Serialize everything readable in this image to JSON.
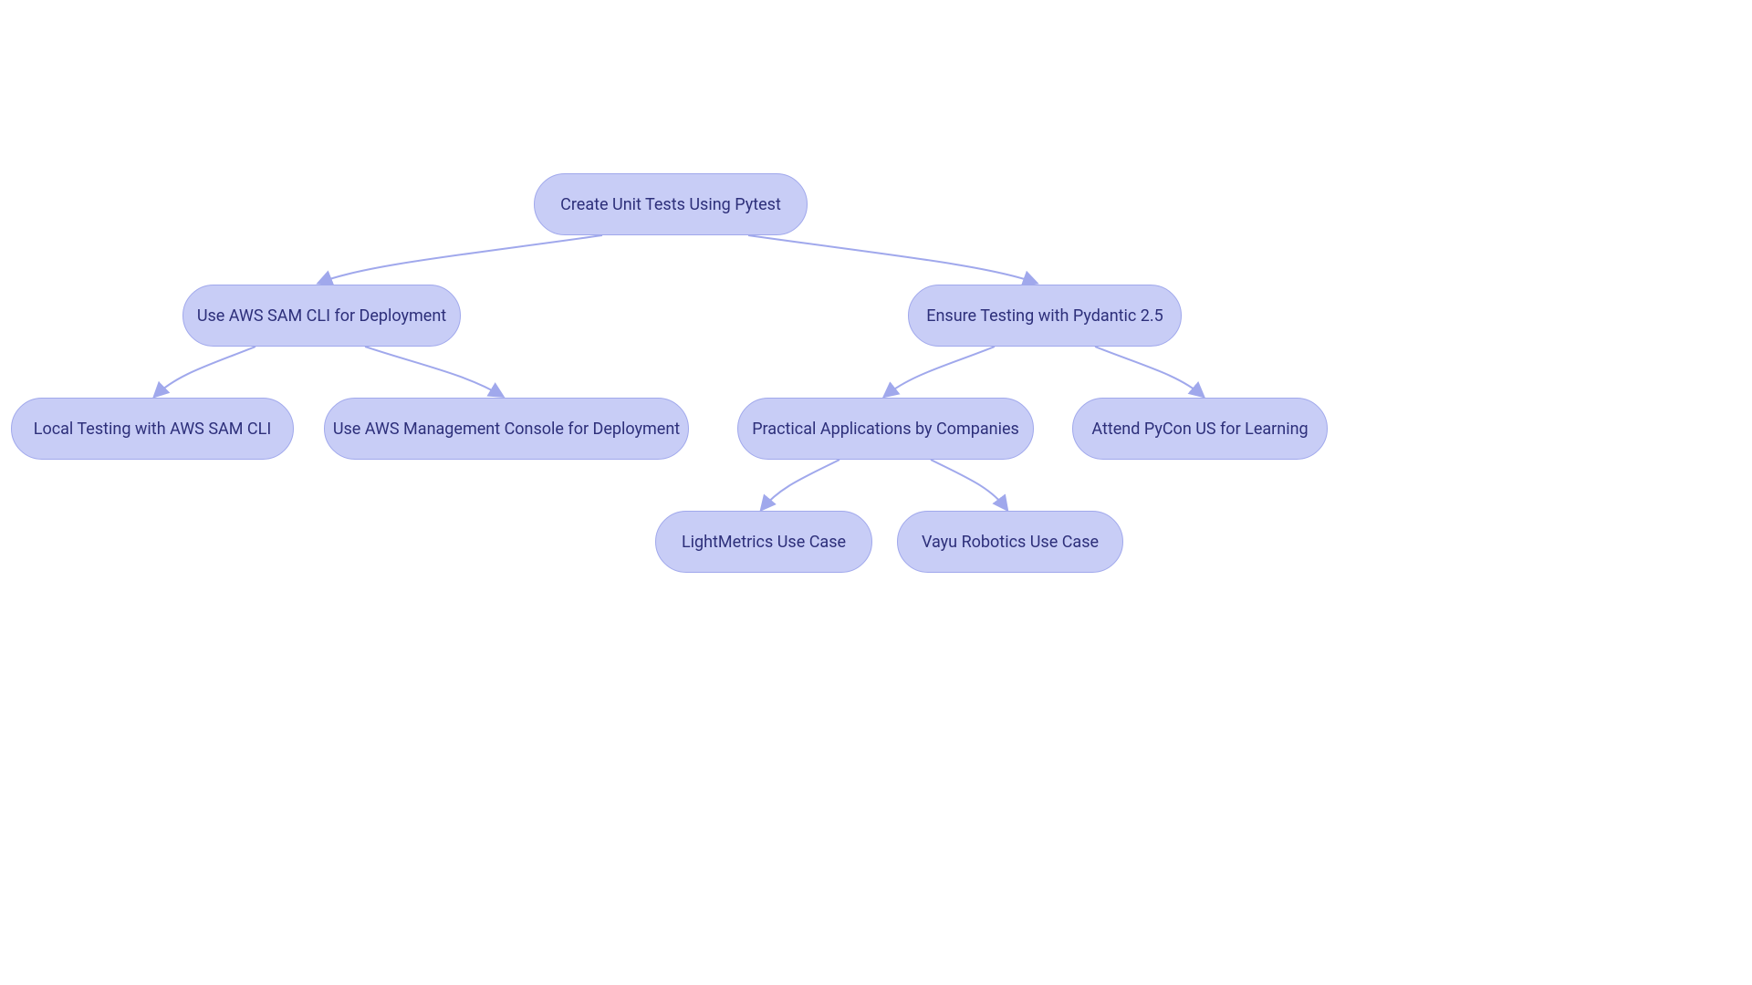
{
  "nodes": {
    "root": {
      "label": "Create Unit Tests Using Pytest"
    },
    "sam": {
      "label": "Use AWS SAM CLI for Deployment"
    },
    "pydantic": {
      "label": "Ensure Testing with Pydantic 2.5"
    },
    "local": {
      "label": "Local Testing with AWS SAM CLI"
    },
    "console": {
      "label": "Use AWS Management Console for Deployment"
    },
    "practical": {
      "label": "Practical Applications by Companies"
    },
    "pycon": {
      "label": "Attend PyCon US for Learning"
    },
    "light": {
      "label": "LightMetrics Use Case"
    },
    "vayu": {
      "label": "Vayu Robotics Use Case"
    }
  },
  "colors": {
    "node_fill": "#c8cdf6",
    "node_border": "#a0a8ec",
    "node_text": "#2d2f7a",
    "edge": "#a0a8ec"
  }
}
